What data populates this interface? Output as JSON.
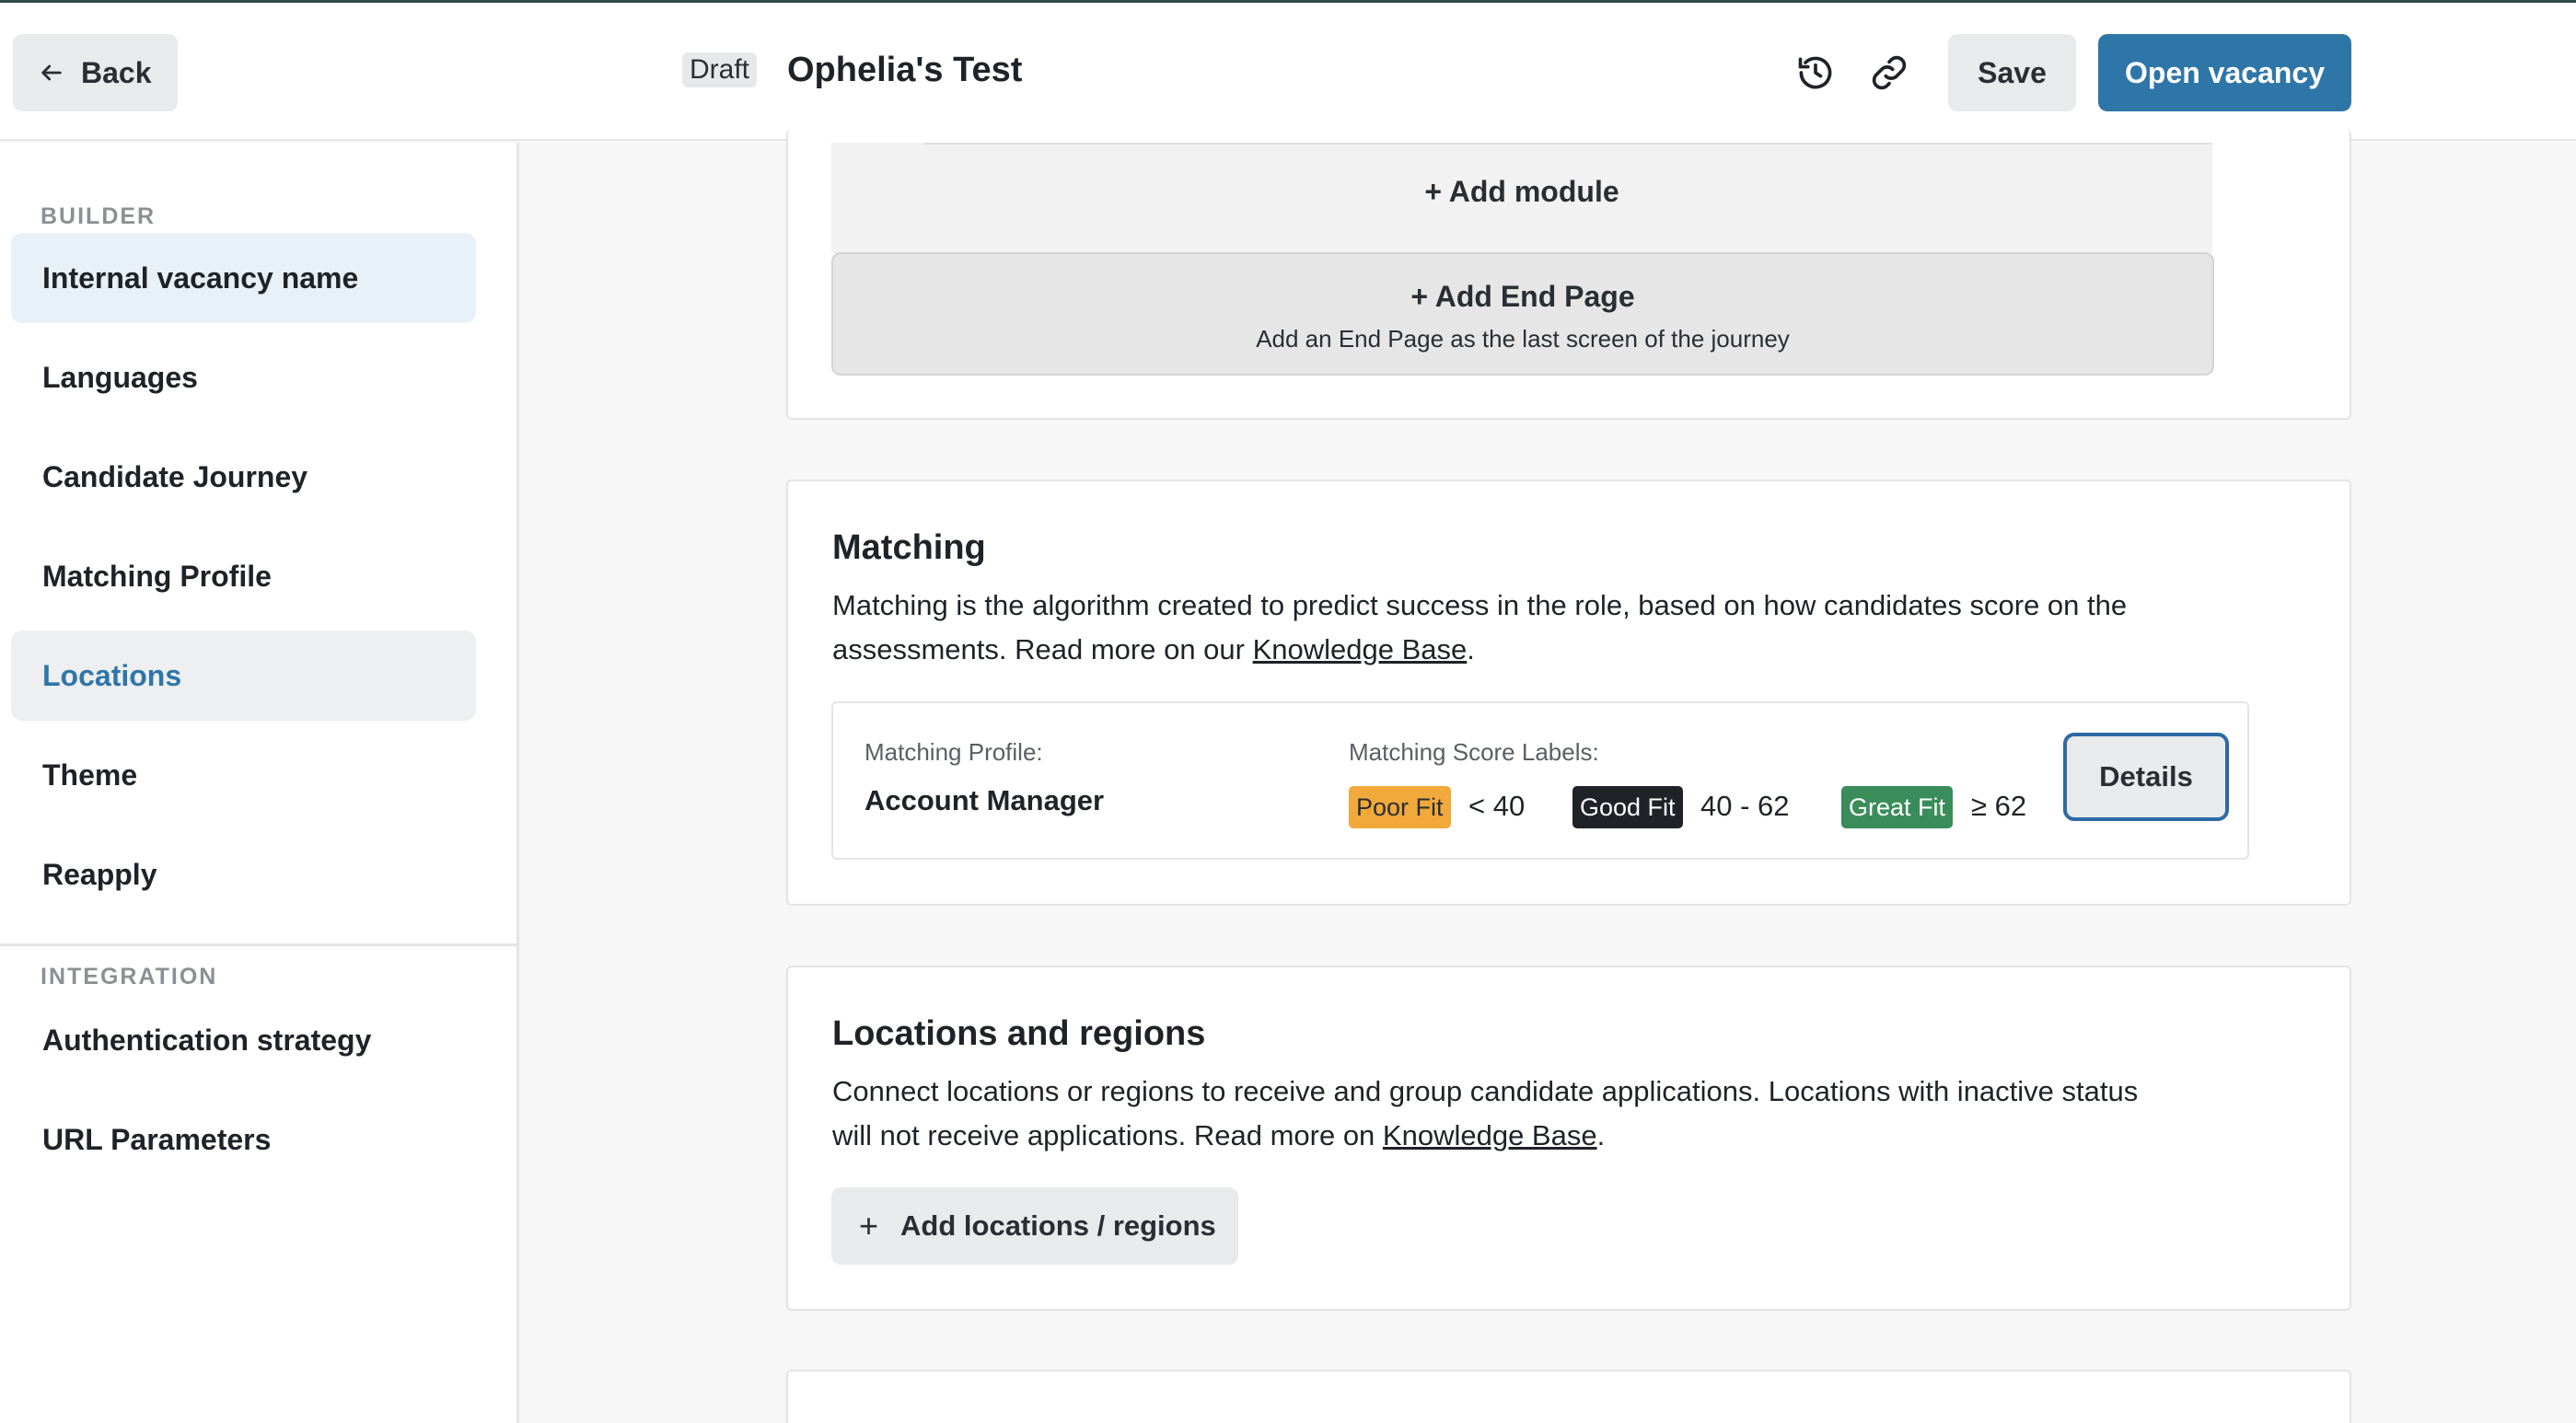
{
  "header": {
    "back_label": "Back",
    "draft_badge": "Draft",
    "title": "Ophelia's Test",
    "save_label": "Save",
    "open_label": "Open vacancy"
  },
  "sidebar": {
    "builder_label": "BUILDER",
    "builder_items": [
      {
        "label": "Internal vacancy name"
      },
      {
        "label": "Languages"
      },
      {
        "label": "Candidate Journey"
      },
      {
        "label": "Matching Profile"
      },
      {
        "label": "Locations"
      },
      {
        "label": "Theme"
      },
      {
        "label": "Reapply"
      }
    ],
    "integration_label": "INTEGRATION",
    "integration_items": [
      {
        "label": "Authentication strategy"
      },
      {
        "label": "URL Parameters"
      }
    ]
  },
  "journey": {
    "add_module": "+ Add module",
    "end_page_title": "+ Add End Page",
    "end_page_sub": "Add an End Page as the last screen of the journey"
  },
  "matching": {
    "title": "Matching",
    "desc_line1": "Matching is the algorithm created to predict success in the role, based on how candidates score on the",
    "desc_line2_pre": "assessments. Read more on our ",
    "kb_link": "Knowledge Base",
    "desc_line2_post": ".",
    "profile_label": "Matching Profile:",
    "profile_value": "Account Manager",
    "score_labels_label": "Matching Score Labels:",
    "labels": [
      {
        "tag": "Poor Fit",
        "range": "< 40",
        "color": "#f2a93b"
      },
      {
        "tag": "Good Fit",
        "range": "40 - 62",
        "color": "#1f2328"
      },
      {
        "tag": "Great Fit",
        "range": "≥ 62",
        "color": "#3a8d5b"
      }
    ],
    "details_label": "Details"
  },
  "locations": {
    "title": "Locations and regions",
    "desc_line1": "Connect locations or regions to receive and group candidate applications. Locations with inactive status",
    "desc_line2_pre": "will not receive applications. Read more on ",
    "kb_link": "Knowledge Base",
    "desc_line2_post": ".",
    "add_label": "Add locations / regions"
  },
  "colors": {
    "accent": "#2f76a8",
    "active_nav_bg": "#eeeff0",
    "hover_nav_bg": "#e9f1f8"
  }
}
